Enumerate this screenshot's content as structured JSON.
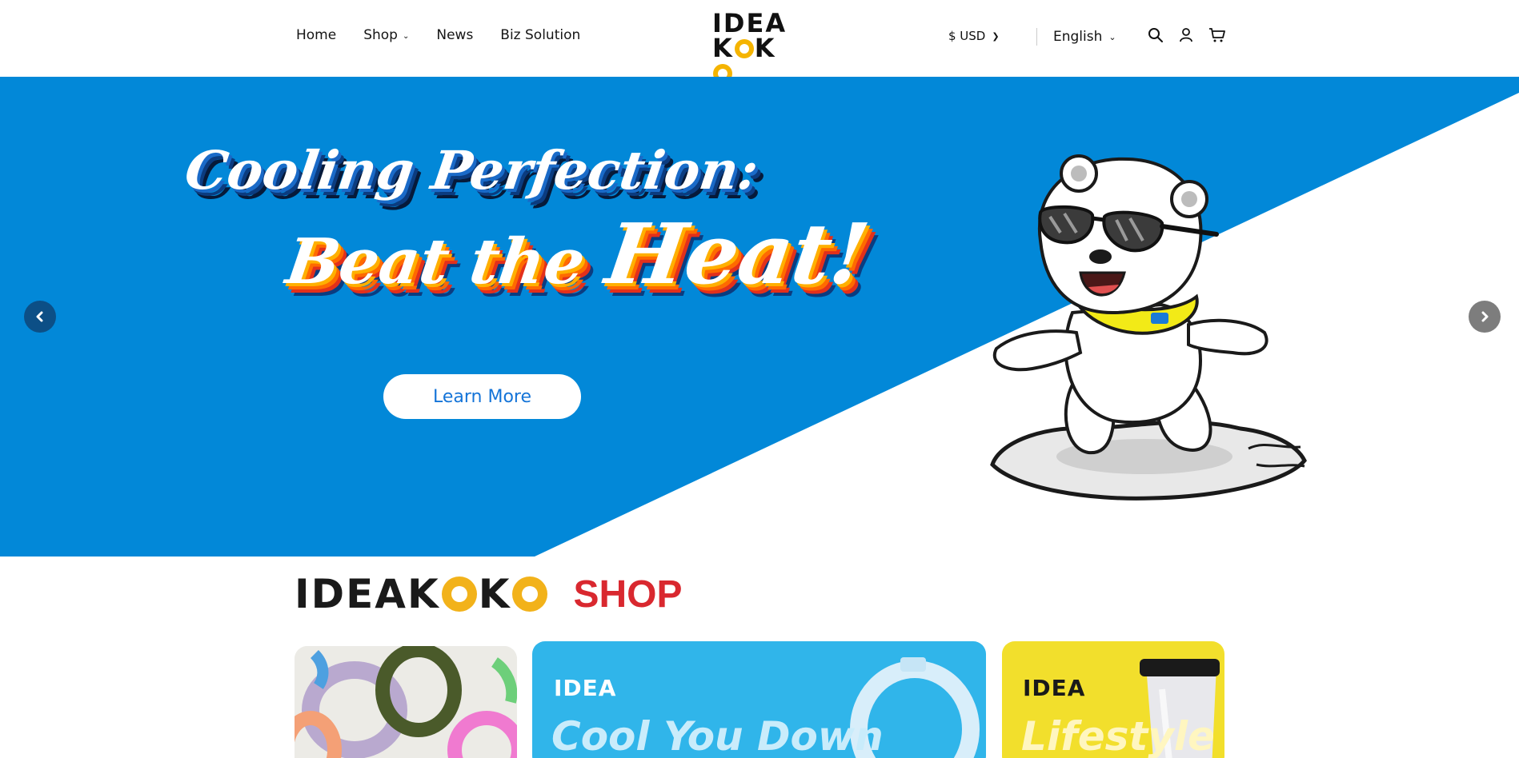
{
  "header": {
    "nav": [
      {
        "label": "Home",
        "has_dropdown": false
      },
      {
        "label": "Shop",
        "has_dropdown": true
      },
      {
        "label": "News",
        "has_dropdown": false
      },
      {
        "label": "Biz Solution",
        "has_dropdown": false
      }
    ],
    "logo": {
      "line1": "IDEA",
      "line2_left": "K",
      "line2_mid": "K"
    },
    "currency": "$ USD",
    "language": "English",
    "icons": [
      "search-icon",
      "user-icon",
      "cart-icon"
    ]
  },
  "hero": {
    "line1": "Cooling Perfection:",
    "line2_a": "Beat the ",
    "line2_b": "Heat!",
    "button": "Learn More",
    "colors": {
      "blue": "#0288d8",
      "button_text": "#1474d8"
    }
  },
  "shop_section": {
    "brand_a": "IDEAK",
    "brand_b": "K",
    "word": "SHOP",
    "word_color": "#d9282f",
    "cards": [
      {
        "idea": "",
        "headline": ""
      },
      {
        "idea": "IDEA",
        "headline": "Cool You Down"
      },
      {
        "idea": "IDEA",
        "headline": "Lifestyle"
      }
    ]
  }
}
